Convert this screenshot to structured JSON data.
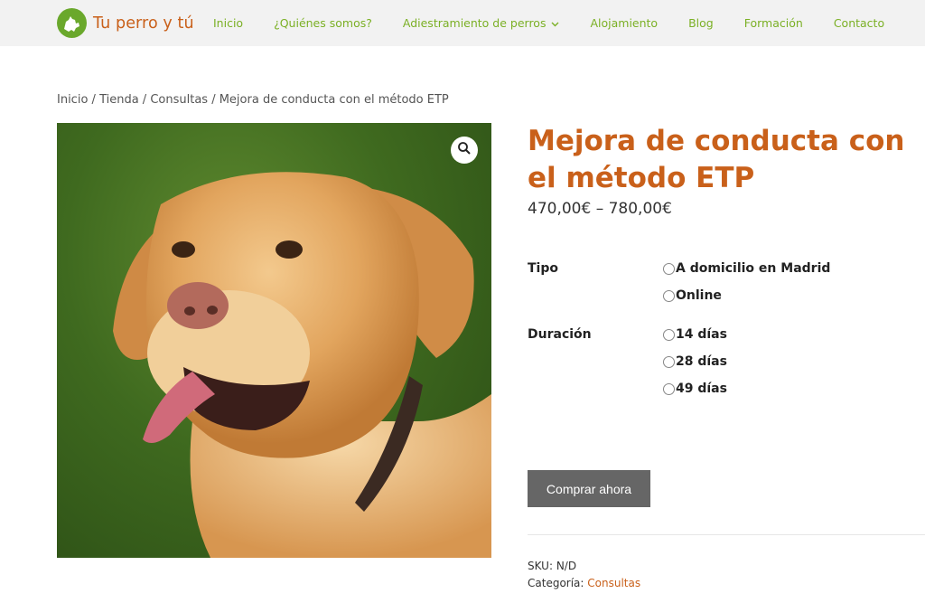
{
  "header": {
    "brand": "Tu perro y tú",
    "logo_icon": "dog-silhouette-icon",
    "nav": [
      {
        "label": "Inicio"
      },
      {
        "label": "¿Quiénes somos?"
      },
      {
        "label": "Adiestramiento de perros",
        "has_dropdown": true
      },
      {
        "label": "Alojamiento"
      },
      {
        "label": "Blog"
      },
      {
        "label": "Formación"
      },
      {
        "label": "Contacto"
      }
    ]
  },
  "breadcrumb": {
    "items": [
      "Inicio",
      "Tienda",
      "Consultas"
    ],
    "separator": " / ",
    "current": "Mejora de conducta con el método ETP"
  },
  "product": {
    "title": "Mejora de conducta con el método ETP",
    "price": "470,00€ – 780,00€",
    "image_icon": "labrador-dog-photo",
    "zoom_icon": "magnifier-icon",
    "variations": [
      {
        "label": "Tipo",
        "options": [
          "A domicilio en Madrid",
          "Online"
        ]
      },
      {
        "label": "Duración",
        "options": [
          "14 días",
          "28 días",
          "49 días"
        ]
      }
    ],
    "buy_label": "Comprar ahora",
    "sku_label": "SKU:",
    "sku_value": "N/D",
    "category_label": "Categoría:",
    "category_value": "Consultas"
  },
  "colors": {
    "brand_orange": "#c9601a",
    "nav_green": "#7bb025",
    "logo_green": "#6aa82c",
    "button_gray": "#666666",
    "header_bg": "#f2f2f2"
  }
}
